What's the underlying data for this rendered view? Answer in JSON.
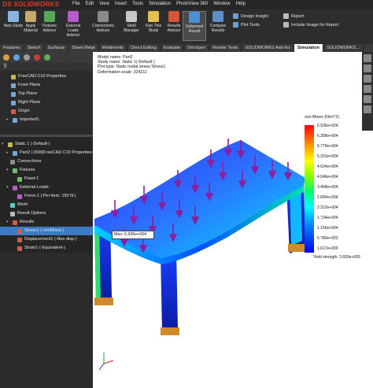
{
  "app": {
    "logo": "DS SOLIDWORKS"
  },
  "menu": [
    "File",
    "Edit",
    "View",
    "Insert",
    "Tools",
    "Simulation",
    "PhotoView 360",
    "Window",
    "Help"
  ],
  "ribbon": {
    "buttons": [
      "New Study",
      "Apply Material",
      "Fixtures Advisor",
      "External Loads Advisor",
      "Connections Advisor",
      "Shell Manager",
      "Run This Study",
      "Results Advisor",
      "Deformed Result",
      "Compare Results"
    ],
    "right_col1": [
      "Design Insight",
      "Plot Tools"
    ],
    "right_col2": [
      "Report",
      "Include Image for Report"
    ]
  },
  "tabs": [
    "Features",
    "Sketch",
    "Surfaces",
    "Sheet Metal",
    "Weldments",
    "Direct Editing",
    "Evaluate",
    "DimXpert",
    "Render Tools",
    "SOLIDWORKS Add-Ins",
    "Simulation",
    "SOLIDWORKS..."
  ],
  "active_tab": "Simulation",
  "tree_upper": [
    "FreeCAD C10 Properties",
    "Front Plane",
    "Top Plane",
    "Right Plane",
    "Origin",
    "Imported1"
  ],
  "tree_lower": [
    "Static 1 (-Default-)",
    "Part2 (-[SW]FreeCAD C10 Properties-)",
    "Connections",
    "Fixtures",
    "Fixed-1",
    "External Loads",
    "Force-1 (:Per item: 150 N:)",
    "Mesh",
    "Result Options",
    "Results",
    "Stress1 (-vonMises-)",
    "Displacement1 (-Res disp-)",
    "Strain1 (-Equivalent-)"
  ],
  "info": [
    "Model name: Part2",
    "Study name: Static 1(-Default-)",
    "Plot type: Static nodal stress Stress1",
    "Deformation scale: 324211"
  ],
  "legend": {
    "title": "von Mises (N/m^2)",
    "ticks": [
      "6.936e+004",
      "6.358e+004",
      "5.779e+004",
      "5.201e+004",
      "4.624e+004",
      "4.046e+004",
      "3.468e+004",
      "2.890e+004",
      "2.312e+004",
      "1.734e+004",
      "1.156e+004",
      "5.780e+003",
      "1.617e+000"
    ],
    "yield": "Yield strength: 3.600e+005"
  },
  "probe": "Max: 6.936e+004",
  "colors": {
    "accent": "#3c7bc4",
    "titlebar": "#262626",
    "ribbon": "#2d2d2d",
    "logo": "#e23a2a"
  }
}
